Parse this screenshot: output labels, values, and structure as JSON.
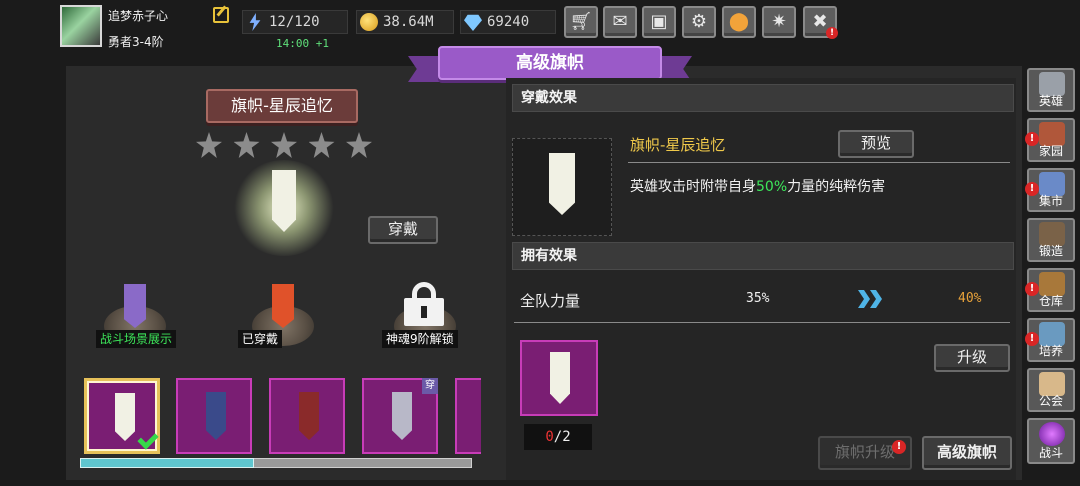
{
  "player": {
    "name": "追梦赤子心",
    "rank": "勇者3-4阶"
  },
  "resources": {
    "energy": "12/120",
    "energy_regen": "14:00 +1",
    "gold": "38.64M",
    "gems": "69240"
  },
  "toolbar": {
    "icons": [
      "shop-icon",
      "mail-icon",
      "gamepad-icon",
      "settings-icon",
      "color-wheel-icon",
      "feather-icon",
      "no-icon"
    ]
  },
  "title": "高级旗帜",
  "left": {
    "item_name": "旗帜-星辰追忆",
    "stars_total": 5,
    "wear_button": "穿戴",
    "pedestals": [
      {
        "label": "战斗场景展示",
        "style": "green"
      },
      {
        "label": "已穿戴",
        "style": "white"
      },
      {
        "label": "神魂9阶解锁",
        "style": "white"
      }
    ],
    "wear_tag": "穿",
    "scroll_progress": 0.44
  },
  "right": {
    "wear_effect_header": "穿戴效果",
    "item_name": "旗帜-星辰追忆",
    "preview_button": "预览",
    "desc_prefix": "英雄攻击时附带自身",
    "desc_value": "50%",
    "desc_suffix": "力量的纯粹伤害",
    "own_effect_header": "拥有效果",
    "attr_name": "全队力量",
    "attr_current": "35%",
    "attr_next": "40%",
    "material_have": "0",
    "material_need": "/2",
    "upgrade_button": "升级",
    "flag_upgrade_button": "旗帜升级",
    "advanced_flag_button": "高级旗帜"
  },
  "side_nav": [
    {
      "label": "英雄"
    },
    {
      "label": "家园"
    },
    {
      "label": "集市"
    },
    {
      "label": "锻造"
    },
    {
      "label": "仓库"
    },
    {
      "label": "培养"
    },
    {
      "label": "公会"
    },
    {
      "label": "战斗"
    }
  ],
  "alert_mark": "!",
  "colors": {
    "accent_purple": "#9a5ac8",
    "slot_magenta": "#7a1e73",
    "highlight_green": "#3de65a",
    "next_value_orange": "#e8a23a"
  }
}
